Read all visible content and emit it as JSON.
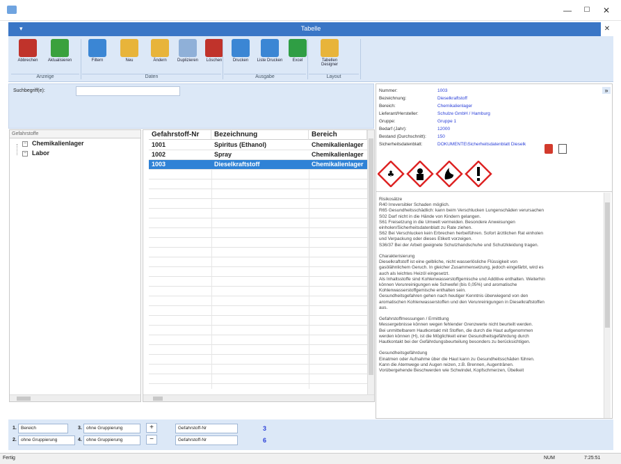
{
  "window": {
    "title": "Tabelle",
    "minimize": "—",
    "maximize": "☐",
    "close": "✕"
  },
  "ribbon": {
    "buttons": [
      {
        "label": "Abbrechen",
        "color": "#c0332b"
      },
      {
        "label": "Aktualisieren",
        "color": "#3aa13d"
      },
      {
        "label": "Filtern",
        "color": "#3b86d4"
      },
      {
        "label": "Neu",
        "color": "#e8b43a"
      },
      {
        "label": "Ändern",
        "color": "#e8b43a"
      },
      {
        "label": "Duplizieren",
        "color": "#8fb0d8"
      },
      {
        "label": "Löschen",
        "color": "#c0332b"
      },
      {
        "label": "Drucken",
        "color": "#3b86d4"
      },
      {
        "label": "Liste Drucken",
        "color": "#3b86d4"
      },
      {
        "label": "Excel",
        "color": "#2f9e44"
      },
      {
        "label": "Tabellen Designer",
        "color": "#e8b43a"
      }
    ],
    "groups": [
      "Anzeige",
      "Daten",
      "Ausgabe",
      "Layout"
    ]
  },
  "search": {
    "label": "Suchbegriff(e):",
    "value": ""
  },
  "tree": {
    "header": "Gefahrstoffe",
    "items": [
      "Chemikalienlager",
      "Labor"
    ]
  },
  "grid": {
    "columns": [
      "Gefahrstoff-Nr",
      "Bezeichnung",
      "Bereich"
    ],
    "rows": [
      [
        "1001",
        "Spiritus (Ethanol)",
        "Chemikalienlager"
      ],
      [
        "1002",
        "Spray",
        "Chemikalienlager"
      ],
      [
        "1003",
        "Dieselkraftstoff",
        "Chemikalienlager"
      ]
    ],
    "selected_row": 2
  },
  "details": {
    "fields": [
      {
        "label": "Nummer:",
        "value": "1003"
      },
      {
        "label": "Bezeichnung:",
        "value": "Dieselkraftstoff"
      },
      {
        "label": "Bereich:",
        "value": "Chemikalienlager"
      },
      {
        "label": "Lieferant/Hersteller:",
        "value": "Schulze GmbH / Hamburg"
      },
      {
        "label": "Gruppe:",
        "value": "Gruppe 1"
      },
      {
        "label": "Bedarf (Jahr):",
        "value": "12000"
      },
      {
        "label": "Bestand (Durchschnitt):",
        "value": "150"
      },
      {
        "label": "Sicherheitsdatenblatt:",
        "value": "DOKUMENTE\\Sicherheitsdatenblatt Dieselk"
      }
    ],
    "expand_button": "»",
    "description": "Risikosätze\nR40 Irreversibler Schaden möglich.\nR65 Gesundheitsschädlich: kann beim Verschlucken Lungenschäden verursachen\nS02 Darf nicht in die Hände von Kindern gelangen.\nS61 Freisetzung in die Umwelt vermeiden. Besondere Anweisungen\neinholen/Sicherheitsdatenblatt zu Rate ziehen.\nS62 Bei Verschlucken kein Erbrechen herbeiführen. Sofort ärztlichen Rat einholen\nund Verpackung oder dieses Etikett vorzeigen.\nS36/37 Bei der Arbeit geeignete Schutzhandschuhe und Schutzkleidung tragen.\n\nCharakterisierung\nDieselkraftstoff ist eine gelbliche, nicht wasserlösliche Flüssigkeit von\ngasölähnlichem Geruch. In gleicher Zusammensetzung, jedoch eingefärbt, wird es\nauch als leichtes Heizöl eingesetzt.\nAls Inhaltsstoffe sind Kohlenwasserstoffgemische und Additive enthalten. Weiterhin\nkönnen Verunreinigungen wie Schwefel (bis 0,05%) und aromatische\nKohlenwasserstoffgemische enthalten sein.\nGesundheitsgefahren gehen nach heutiger Kenntnis überwiegend von den\naromatischen Kohlenwasserstoffen und den Verunreinigungen in Dieselkraftstoffen\naus.\n\nGefahrstoffmessungen / Ermittlung\nMessergebnisse können wegen fehlender Grenzwerte nicht beurteilt werden.\nBei unmittelbarem Hautkontakt mit Stoffen, die durch die Haut aufgenommen\nwerden können (H), ist die Möglichkeit einer Gesundheitsgefährdung durch\nHautkontakt bei der Gefährdungsbeurteilung besonders zu berücksichtigen.\n\nGesundheitsgefährdung\nEinatmen oder Aufnahme über die Haut kann zu Gesundheitsschäden führen.\nKann die Atemwege und Augen reizen, z.B. Brennen, Augentränen.\nVorübergehende Beschwerden wie Schwindel, Kopfschmerzen, Übelkeit"
  },
  "bottom": {
    "row1": {
      "num1": "1.",
      "combo1": "Bereich",
      "num2": "3.",
      "combo2": "ohne Gruppierung",
      "btn": "+",
      "combo3": "Gefahrstoff-Nr",
      "count": "3"
    },
    "row2": {
      "num1": "2.",
      "combo1": "ohne Gruppierung",
      "num2": "4.",
      "combo2": "ohne Gruppierung",
      "btn": "−",
      "combo3": "Gefahrstoff-Nr",
      "count": "6"
    }
  },
  "status": {
    "left": "Fertig",
    "num": "NUM",
    "time": "7:25:51"
  }
}
